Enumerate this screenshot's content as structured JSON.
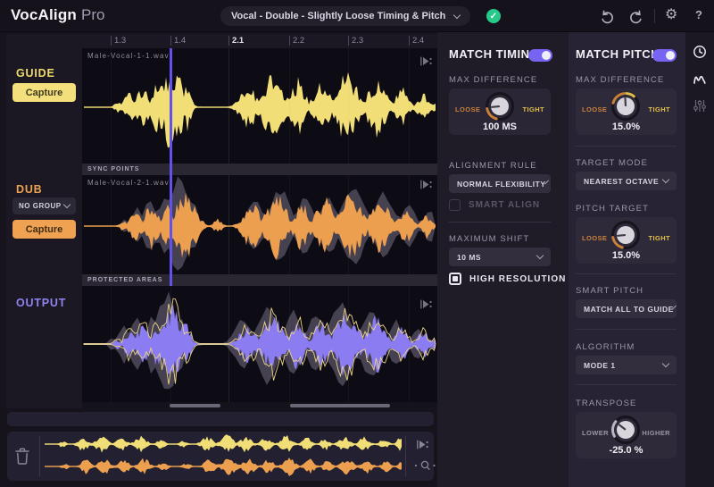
{
  "app": {
    "name_bold": "VocAlign",
    "name_light": "Pro"
  },
  "topbar": {
    "preset_value": "Vocal - Double - Slightly Loose Timing & Pitch",
    "help_label": "?"
  },
  "ruler": {
    "ticks": [
      "1.3",
      "1.4",
      "2.1",
      "2.2",
      "2.3",
      "2.4"
    ]
  },
  "tracks": {
    "guide": {
      "name": "GUIDE",
      "capture_label": "Capture",
      "file": "Male-Vocal-1-1.wav"
    },
    "sync_points_label": "SYNC POINTS",
    "dub": {
      "name": "DUB",
      "group_value": "NO GROUP",
      "capture_label": "Capture",
      "file": "Male-Vocal-2-1.wav"
    },
    "protected_areas_label": "PROTECTED AREAS",
    "output": {
      "name": "OUTPUT"
    }
  },
  "timing_panel": {
    "title": "MATCH TIMING",
    "enabled": true,
    "max_difference": {
      "label": "MAX DIFFERENCE",
      "loose_label": "LOOSE",
      "tight_label": "TIGHT",
      "value": "100 MS",
      "pointer_deg": -95
    },
    "alignment_rule": {
      "label": "ALIGNMENT RULE",
      "value": "NORMAL FLEXIBILITY"
    },
    "smart_align": {
      "label": "SMART ALIGN",
      "checked": false
    },
    "maximum_shift": {
      "label": "MAXIMUM SHIFT",
      "value": "10 MS"
    },
    "high_resolution": {
      "label": "HIGH RESOLUTION",
      "checked": true
    }
  },
  "pitch_panel": {
    "title": "MATCH PITCH",
    "enabled": true,
    "max_difference": {
      "label": "MAX DIFFERENCE",
      "loose_label": "LOOSE",
      "tight_label": "TIGHT",
      "value": "15.0%",
      "pointer_deg": -3
    },
    "target_mode": {
      "label": "TARGET MODE",
      "value": "NEAREST OCTAVE"
    },
    "pitch_target": {
      "label": "PITCH TARGET",
      "loose_label": "LOOSE",
      "tight_label": "TIGHT",
      "value": "15.0%",
      "pointer_deg": -95
    },
    "smart_pitch": {
      "label": "SMART PITCH",
      "value": "MATCH ALL TO GUIDE"
    },
    "algorithm": {
      "label": "ALGORITHM",
      "value": "MODE 1"
    },
    "transpose": {
      "label": "TRANSPOSE",
      "lower_label": "LOWER",
      "higher_label": "HIGHER",
      "value": "-25.0 %",
      "pointer_deg": -52
    }
  },
  "colors": {
    "guide_yellow": "#f2de76",
    "dub_orange": "#ec9f4f",
    "output_purple": "#8b7cf2",
    "accent_purple": "#7765f2",
    "saved_green": "#27c98a",
    "loose_orange": "#c8813a",
    "tight_yellow": "#e3bf4a",
    "playhead": "#6252ea",
    "ghost_gray": "#544f60"
  }
}
